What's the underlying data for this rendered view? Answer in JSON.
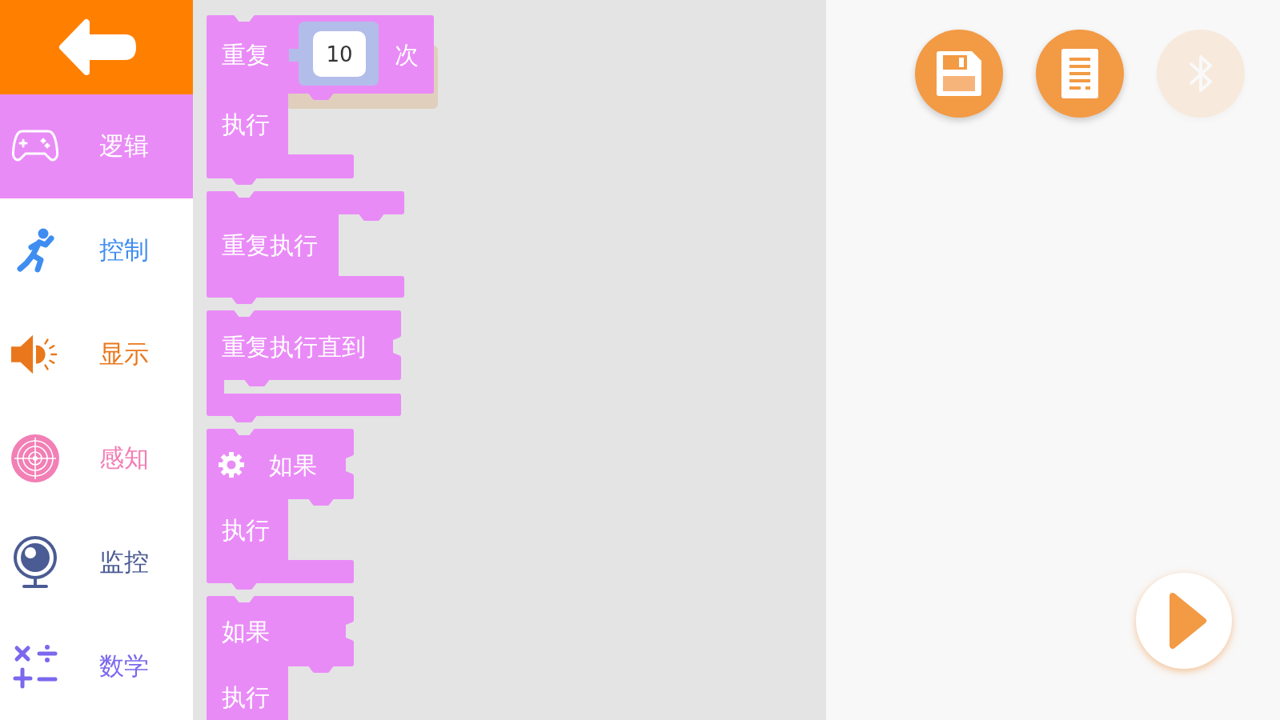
{
  "categories": [
    {
      "kind": "logic",
      "label": "逻辑",
      "color": "#e98bf7",
      "selected": true
    },
    {
      "kind": "control",
      "label": "控制",
      "color": "#3f8df0",
      "selected": false
    },
    {
      "kind": "display",
      "label": "显示",
      "color": "#e9781c",
      "selected": false
    },
    {
      "kind": "sensing",
      "label": "感知",
      "color": "#f27fb5",
      "selected": false
    },
    {
      "kind": "monitor",
      "label": "监控",
      "color": "#4b5b93",
      "selected": false
    },
    {
      "kind": "math",
      "label": "数学",
      "color": "#7b68ee",
      "selected": false
    }
  ],
  "blocks": [
    {
      "kind": "repeat_count",
      "label": "重复",
      "count": "10",
      "unit": "次",
      "do_label": "执行",
      "shadow": true
    },
    {
      "kind": "repeat_forever",
      "label": "重复执行",
      "shadow": false
    },
    {
      "kind": "repeat_until",
      "label": "重复执行直到",
      "shadow": false
    },
    {
      "kind": "if_gear",
      "label": "如果",
      "do_label": "执行",
      "shadow": false
    },
    {
      "kind": "if",
      "label": "如果",
      "do_label": "执行",
      "shadow": false
    }
  ],
  "toolbar": [
    {
      "kind": "save",
      "disabled": false
    },
    {
      "kind": "document",
      "disabled": false
    },
    {
      "kind": "bluetooth",
      "disabled": true
    }
  ]
}
